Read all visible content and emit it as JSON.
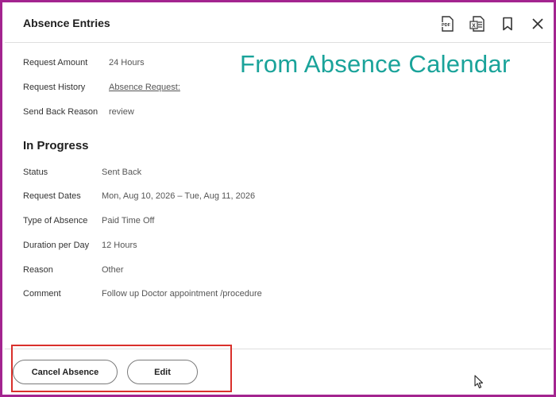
{
  "header": {
    "title": "Absence Entries",
    "icons": [
      "pdf-export-icon",
      "excel-export-icon",
      "bookmark-icon",
      "close-icon"
    ],
    "pdf_text": "PDF",
    "excel_text": "X"
  },
  "watermark": "From Absence Calendar",
  "request": {
    "amount_label": "Request Amount",
    "amount_value": "24 Hours",
    "history_label": "Request History",
    "history_value": "Absence Request:",
    "sendback_label": "Send Back Reason",
    "sendback_value": "review"
  },
  "section_title": "In Progress",
  "details": {
    "status_label": "Status",
    "status_value": "Sent Back",
    "dates_label": "Request Dates",
    "dates_value": "Mon, Aug 10, 2026 – Tue, Aug 11, 2026",
    "type_label": "Type of Absence",
    "type_value": "Paid Time Off",
    "duration_label": "Duration per Day",
    "duration_value": "12 Hours",
    "reason_label": "Reason",
    "reason_value": "Other",
    "comment_label": "Comment",
    "comment_value": "Follow up Doctor appointment /procedure"
  },
  "footer": {
    "cancel_label": "Cancel Absence",
    "edit_label": "Edit"
  },
  "colors": {
    "frame": "#a3248f",
    "watermark": "#1aa39a",
    "link": "#1f6fd6",
    "highlight": "#d9302b"
  }
}
